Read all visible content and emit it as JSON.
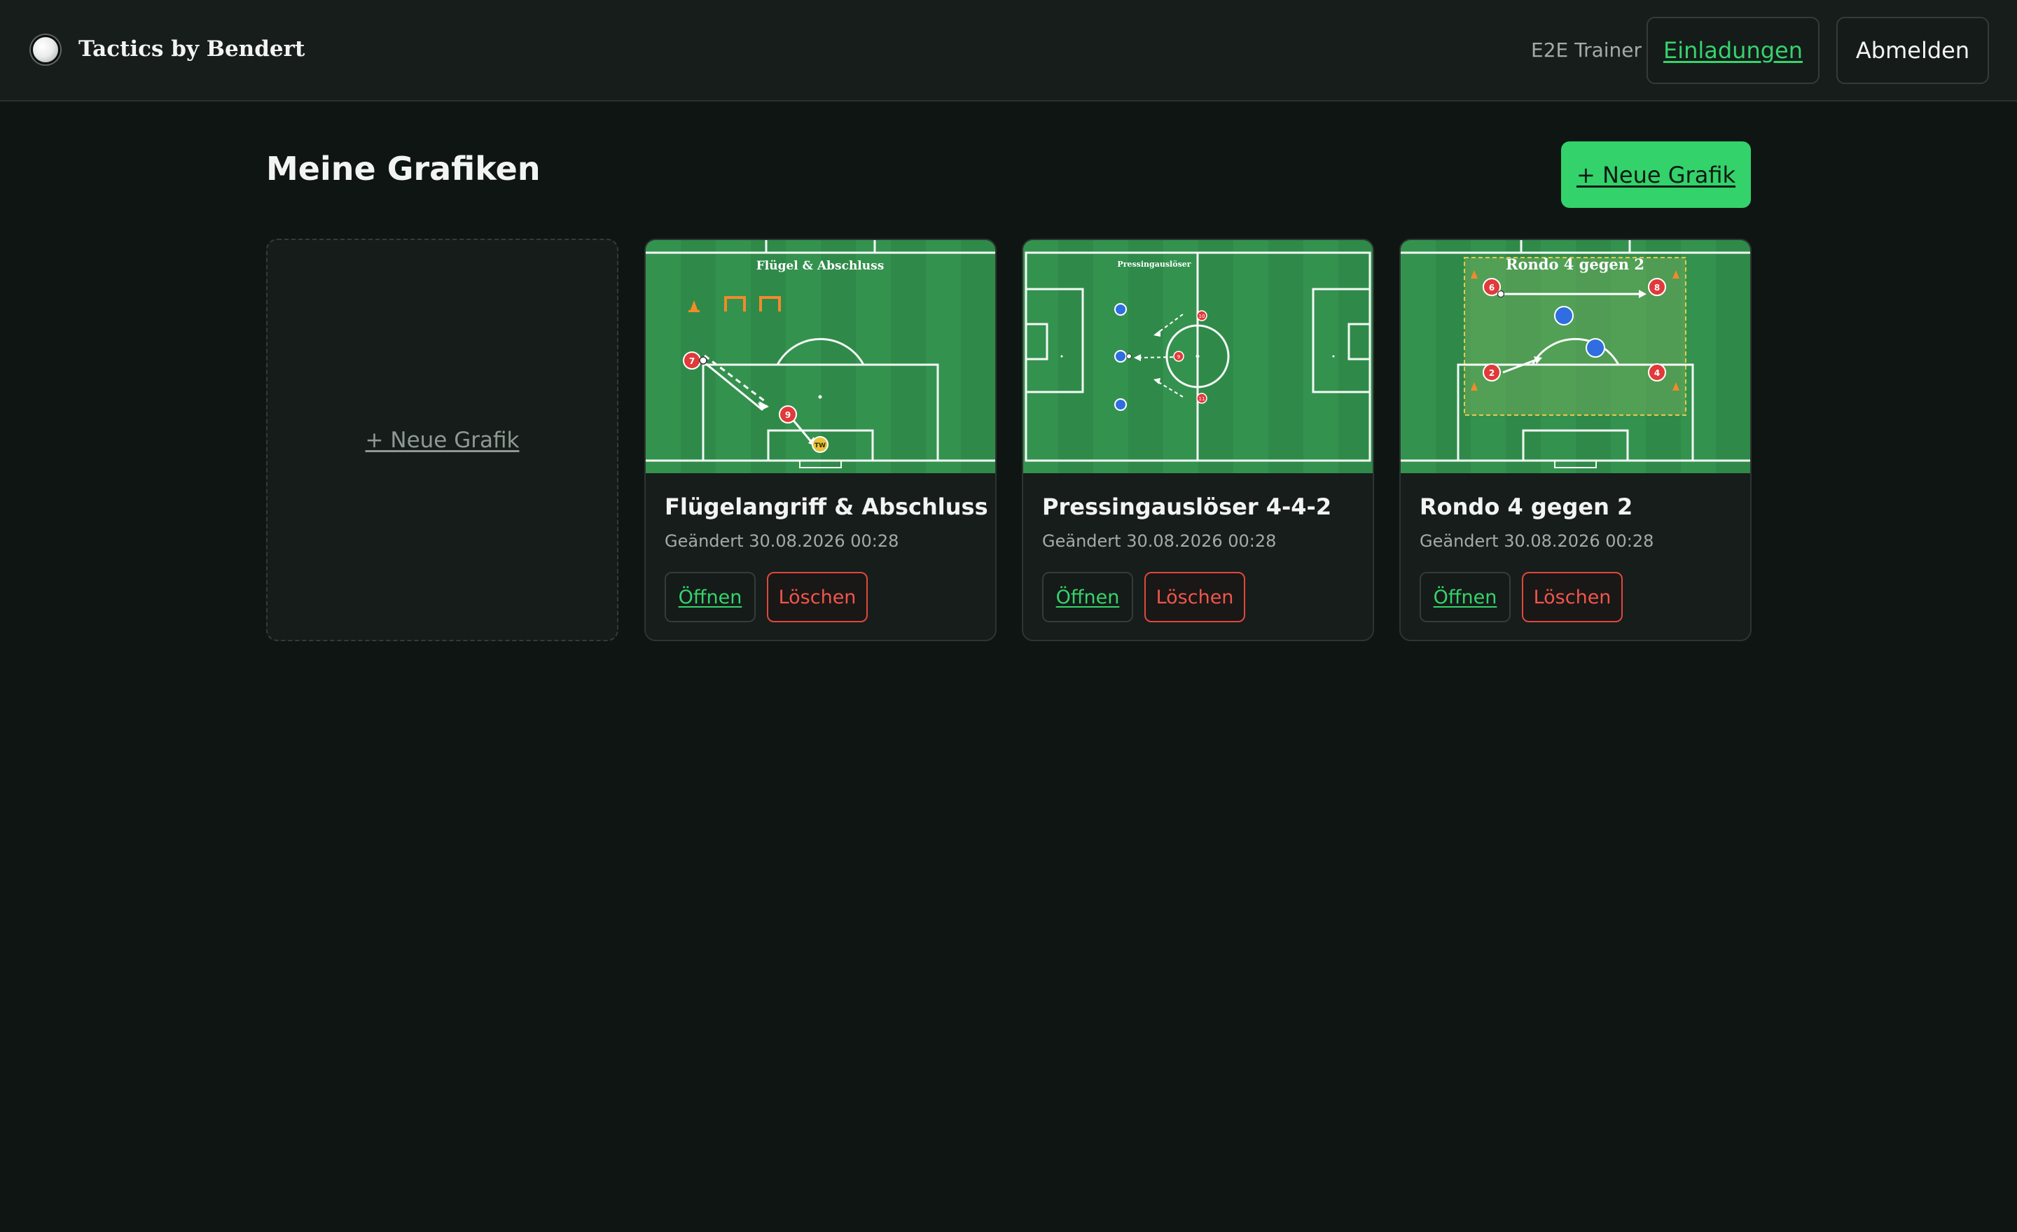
{
  "header": {
    "brand": "Tactics by Bendert",
    "user_name": "E2E Trainer",
    "invites_label": "Einladungen",
    "logout_label": "Abmelden"
  },
  "main": {
    "title": "Meine Grafiken",
    "new_button_label": "+ Neue Grafik",
    "new_card_label": "+ Neue Grafik",
    "cards": [
      {
        "title": "Flügelangriff & Abschluss",
        "modified": "Geändert 30.08.2026 00:28",
        "thumb_label": "Flügel & Abschluss",
        "thumb_players": [
          "7",
          "9"
        ],
        "thumb_keeper": "TW",
        "open_label": "Öffnen",
        "delete_label": "Löschen"
      },
      {
        "title": "Pressingauslöser 4-4-2",
        "modified": "Geändert 30.08.2026 00:28",
        "thumb_label": "Pressingauslöser",
        "thumb_players": [
          "10",
          "9",
          "11"
        ],
        "open_label": "Öffnen",
        "delete_label": "Löschen"
      },
      {
        "title": "Rondo 4 gegen 2",
        "modified": "Geändert 30.08.2026 00:28",
        "thumb_label": "Rondo 4 gegen 2",
        "thumb_players": [
          "6",
          "8",
          "2",
          "4"
        ],
        "open_label": "Öffnen",
        "delete_label": "Löschen"
      }
    ]
  },
  "colors": {
    "background": "#0f1513",
    "accent": "#33d26b",
    "danger": "#e0483c",
    "pitch": "#2f8a49",
    "red_player": "#e03a3a",
    "blue_player": "#2f6ee0",
    "keeper": "#e7c33a"
  }
}
